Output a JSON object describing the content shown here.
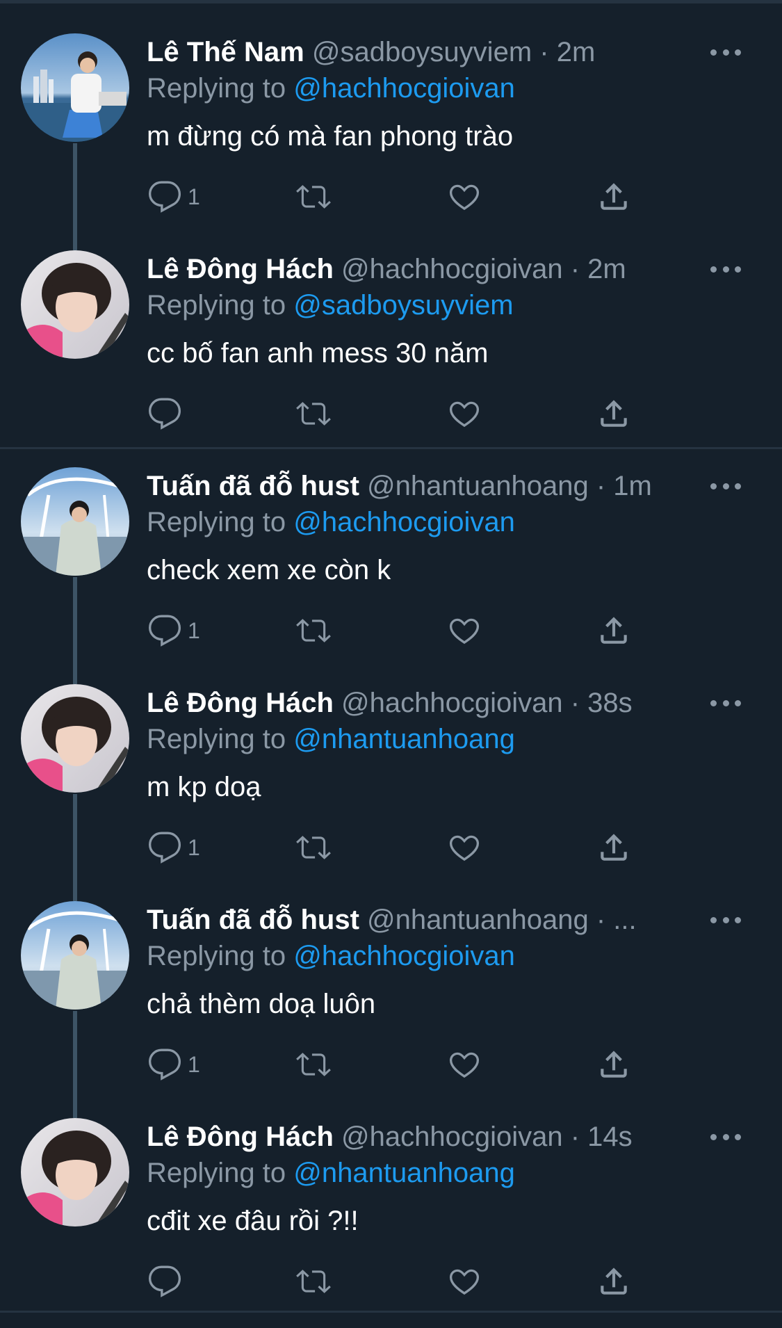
{
  "tweets": [
    {
      "name": "Lê Thế Nam",
      "handle": "@sadboysuyviem",
      "time": "· 2m",
      "reply_prefix": "Replying to ",
      "reply_to": "@hachhocgioivan",
      "text": "m đừng có mà fan phong trào",
      "reply_count": "1"
    },
    {
      "name": "Lê Đông Hách",
      "handle": "@hachhocgioivan",
      "time": "· 2m",
      "reply_prefix": "Replying to ",
      "reply_to": "@sadboysuyviem",
      "text": "cc bố fan anh mess 30 năm",
      "reply_count": ""
    },
    {
      "name": "Tuấn đã đỗ hust",
      "handle": "@nhantuanhoang",
      "time": "· 1m",
      "reply_prefix": "Replying to ",
      "reply_to": "@hachhocgioivan",
      "text": "check xem xe còn k",
      "reply_count": "1"
    },
    {
      "name": "Lê Đông Hách",
      "handle": "@hachhocgioivan",
      "time": "· 38s",
      "reply_prefix": "Replying to ",
      "reply_to": "@nhantuanhoang",
      "text": "m kp doạ",
      "reply_count": "1"
    },
    {
      "name": "Tuấn đã đỗ hust",
      "handle": "@nhantuanhoang",
      "time": "· ...",
      "reply_prefix": "Replying to ",
      "reply_to": "@hachhocgioivan",
      "text": "chả thèm doạ luôn",
      "reply_count": "1"
    },
    {
      "name": "Lê Đông Hách",
      "handle": "@hachhocgioivan",
      "time": "· 14s",
      "reply_prefix": "Replying to ",
      "reply_to": "@nhantuanhoang",
      "text": "cđit xe đâu rồi ?!!",
      "reply_count": ""
    }
  ],
  "icons": {
    "reply": "reply-icon",
    "retweet": "retweet-icon",
    "like": "heart-icon",
    "share": "share-icon",
    "more": "more-icon"
  },
  "colors": {
    "background": "#15202b",
    "text_primary": "#ffffff",
    "text_secondary": "#8b98a5",
    "link": "#1d9bf0",
    "divider": "#253341"
  }
}
